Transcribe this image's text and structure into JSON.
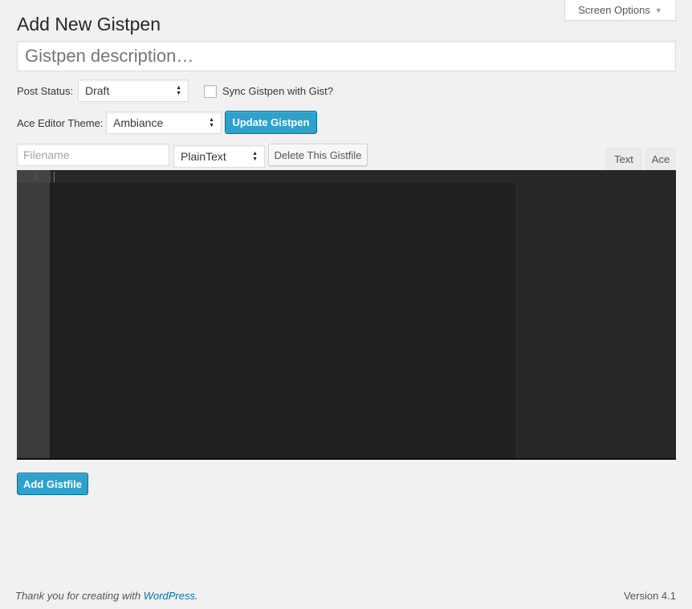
{
  "screen_options": {
    "label": "Screen Options",
    "arrow_icon": "triangle-down-icon"
  },
  "page": {
    "title": "Add New Gistpen"
  },
  "description": {
    "placeholder": "Gistpen description…",
    "value": ""
  },
  "post_status": {
    "label": "Post Status:",
    "selected": "Draft"
  },
  "sync": {
    "label": "Sync Gistpen with Gist?",
    "checked": false
  },
  "theme": {
    "label": "Ace Editor Theme:",
    "selected": "Ambiance"
  },
  "buttons": {
    "update": "Update Gistpen",
    "delete_file": "Delete This Gistfile",
    "add_file": "Add Gistfile"
  },
  "file": {
    "filename_placeholder": "Filename",
    "filename_value": "",
    "language_selected": "PlainText"
  },
  "editor_tabs": [
    {
      "label": "Text"
    },
    {
      "label": "Ace"
    }
  ],
  "editor": {
    "line_numbers": [
      "1"
    ],
    "theme_colors": {
      "background": "#202020",
      "gutter": "#3b3b3b"
    }
  },
  "footer": {
    "thanks_prefix": "Thank you for creating with ",
    "thanks_link": "WordPress",
    "thanks_suffix": ".",
    "version": "Version 4.1"
  },
  "colors": {
    "primary": "#2ea2cc",
    "link": "#0074a2",
    "background": "#f1f1f1"
  }
}
